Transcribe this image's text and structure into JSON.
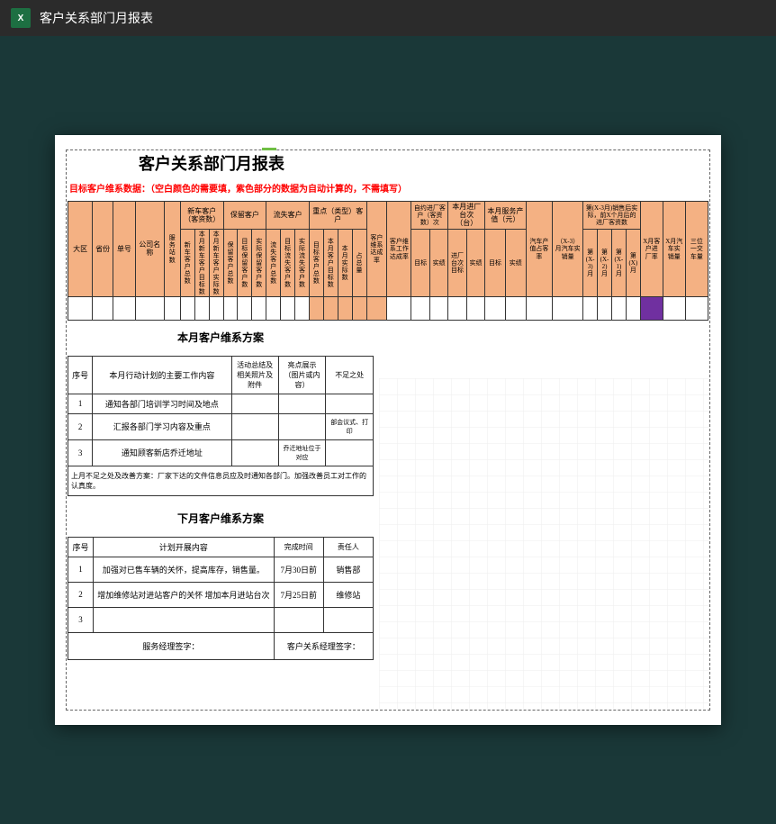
{
  "toolbar": {
    "excel_letter": "X",
    "title": "客户关系部门月报表"
  },
  "doc_title": "客户关系部门月报表",
  "red_note": "目标客户维系数据：（空白颜色的需要填，紫色部分的数据为自动计算的，不需填写）",
  "main_headers": {
    "r1_region": "大区",
    "r1_province": "省份",
    "r1_single": "单号",
    "r1_company": "公司名称",
    "r1_svc": "服务站数",
    "gr_new": "新车客户（客资数）",
    "gr_keep": "保留客户",
    "gr_lost": "流失客户",
    "gr_key": "重点（类型）客户",
    "r1_rate": "客户维系达成率",
    "r1_workrate": "客户维系工作达成率",
    "gr_entry": "自约进厂客户（客资数）次",
    "gr_visit": "本月进厂台次（台）",
    "gr_output": "本月服务产值（元）",
    "r1_carcmp": "汽车产值占客率",
    "r1_prev": "（X-3）月汽车实销量",
    "gr_first": "第(X-3月)销售后实际，前X个月后的进厂客资数",
    "r1_xmonth": "X月客户进厂率",
    "r1_xsale": "X月汽车实销量",
    "r1_3in1": "三位一交车量",
    "sub_new1": "新车客户总数",
    "sub_new2": "本月新车客户目标数",
    "sub_new3": "本月新车客户实际数",
    "sub_keep1": "保留客户总数",
    "sub_keep2": "目标保留客户数",
    "sub_keep3": "实际保留客户数",
    "sub_lost1": "流失客户总数",
    "sub_lost2": "目标流失客户数",
    "sub_lost3": "实际流失客户数",
    "sub_key1": "目标客户总数",
    "sub_key2": "本月客户目标数",
    "sub_key3": "本月实际数",
    "sub_key4": "占总量",
    "sub_t": "目标",
    "sub_a": "实绩",
    "sub_v_t": "进厂台次目标",
    "sub_x31": "第(X-3)月",
    "sub_x32": "第(X-2)月",
    "sub_x33": "第(X-1)月",
    "sub_x34": "第(X)月"
  },
  "plan_this": {
    "title": "本月客户维系方案",
    "h_no": "序号",
    "h_content": "本月行动计划的主要工作内容",
    "h_summary": "活动总结及相关照片及附件",
    "h_show": "亮点展示（图片或内容）",
    "h_lack": "不足之处",
    "rows": [
      {
        "no": "1",
        "content": "通知各部门培训学习时间及地点",
        "summary": "",
        "show": "",
        "lack": ""
      },
      {
        "no": "2",
        "content": "汇报各部门学习内容及重点",
        "summary": "",
        "show": "",
        "lack": "部会议式、打印"
      },
      {
        "no": "3",
        "content": "通知顾客新店乔迁地址",
        "summary": "",
        "show": "乔迁地址位于对应",
        "lack": ""
      }
    ],
    "remark": "上月不足之处及改善方案：厂家下达的文件信息员应及时通知各部门。加强改善员工对工作的认真度。"
  },
  "plan_next": {
    "title": "下月客户维系方案",
    "h_no": "序号",
    "h_content": "计划开展内容",
    "h_done": "完成时间",
    "h_owner": "责任人",
    "rows": [
      {
        "no": "1",
        "content": "加强对已售车辆的关怀，提高库存，销售量。",
        "done": "7月30日前",
        "owner": "销售部"
      },
      {
        "no": "2",
        "content": "增加维修站对进站客户的关怀     增加本月进站台次",
        "done": "7月25日前",
        "owner": "维修站"
      },
      {
        "no": "3",
        "content": "",
        "done": "",
        "owner": ""
      }
    ]
  },
  "sign": {
    "svc_mgr": "服务经理签字：",
    "crm_mgr": "客户关系经理签字："
  }
}
